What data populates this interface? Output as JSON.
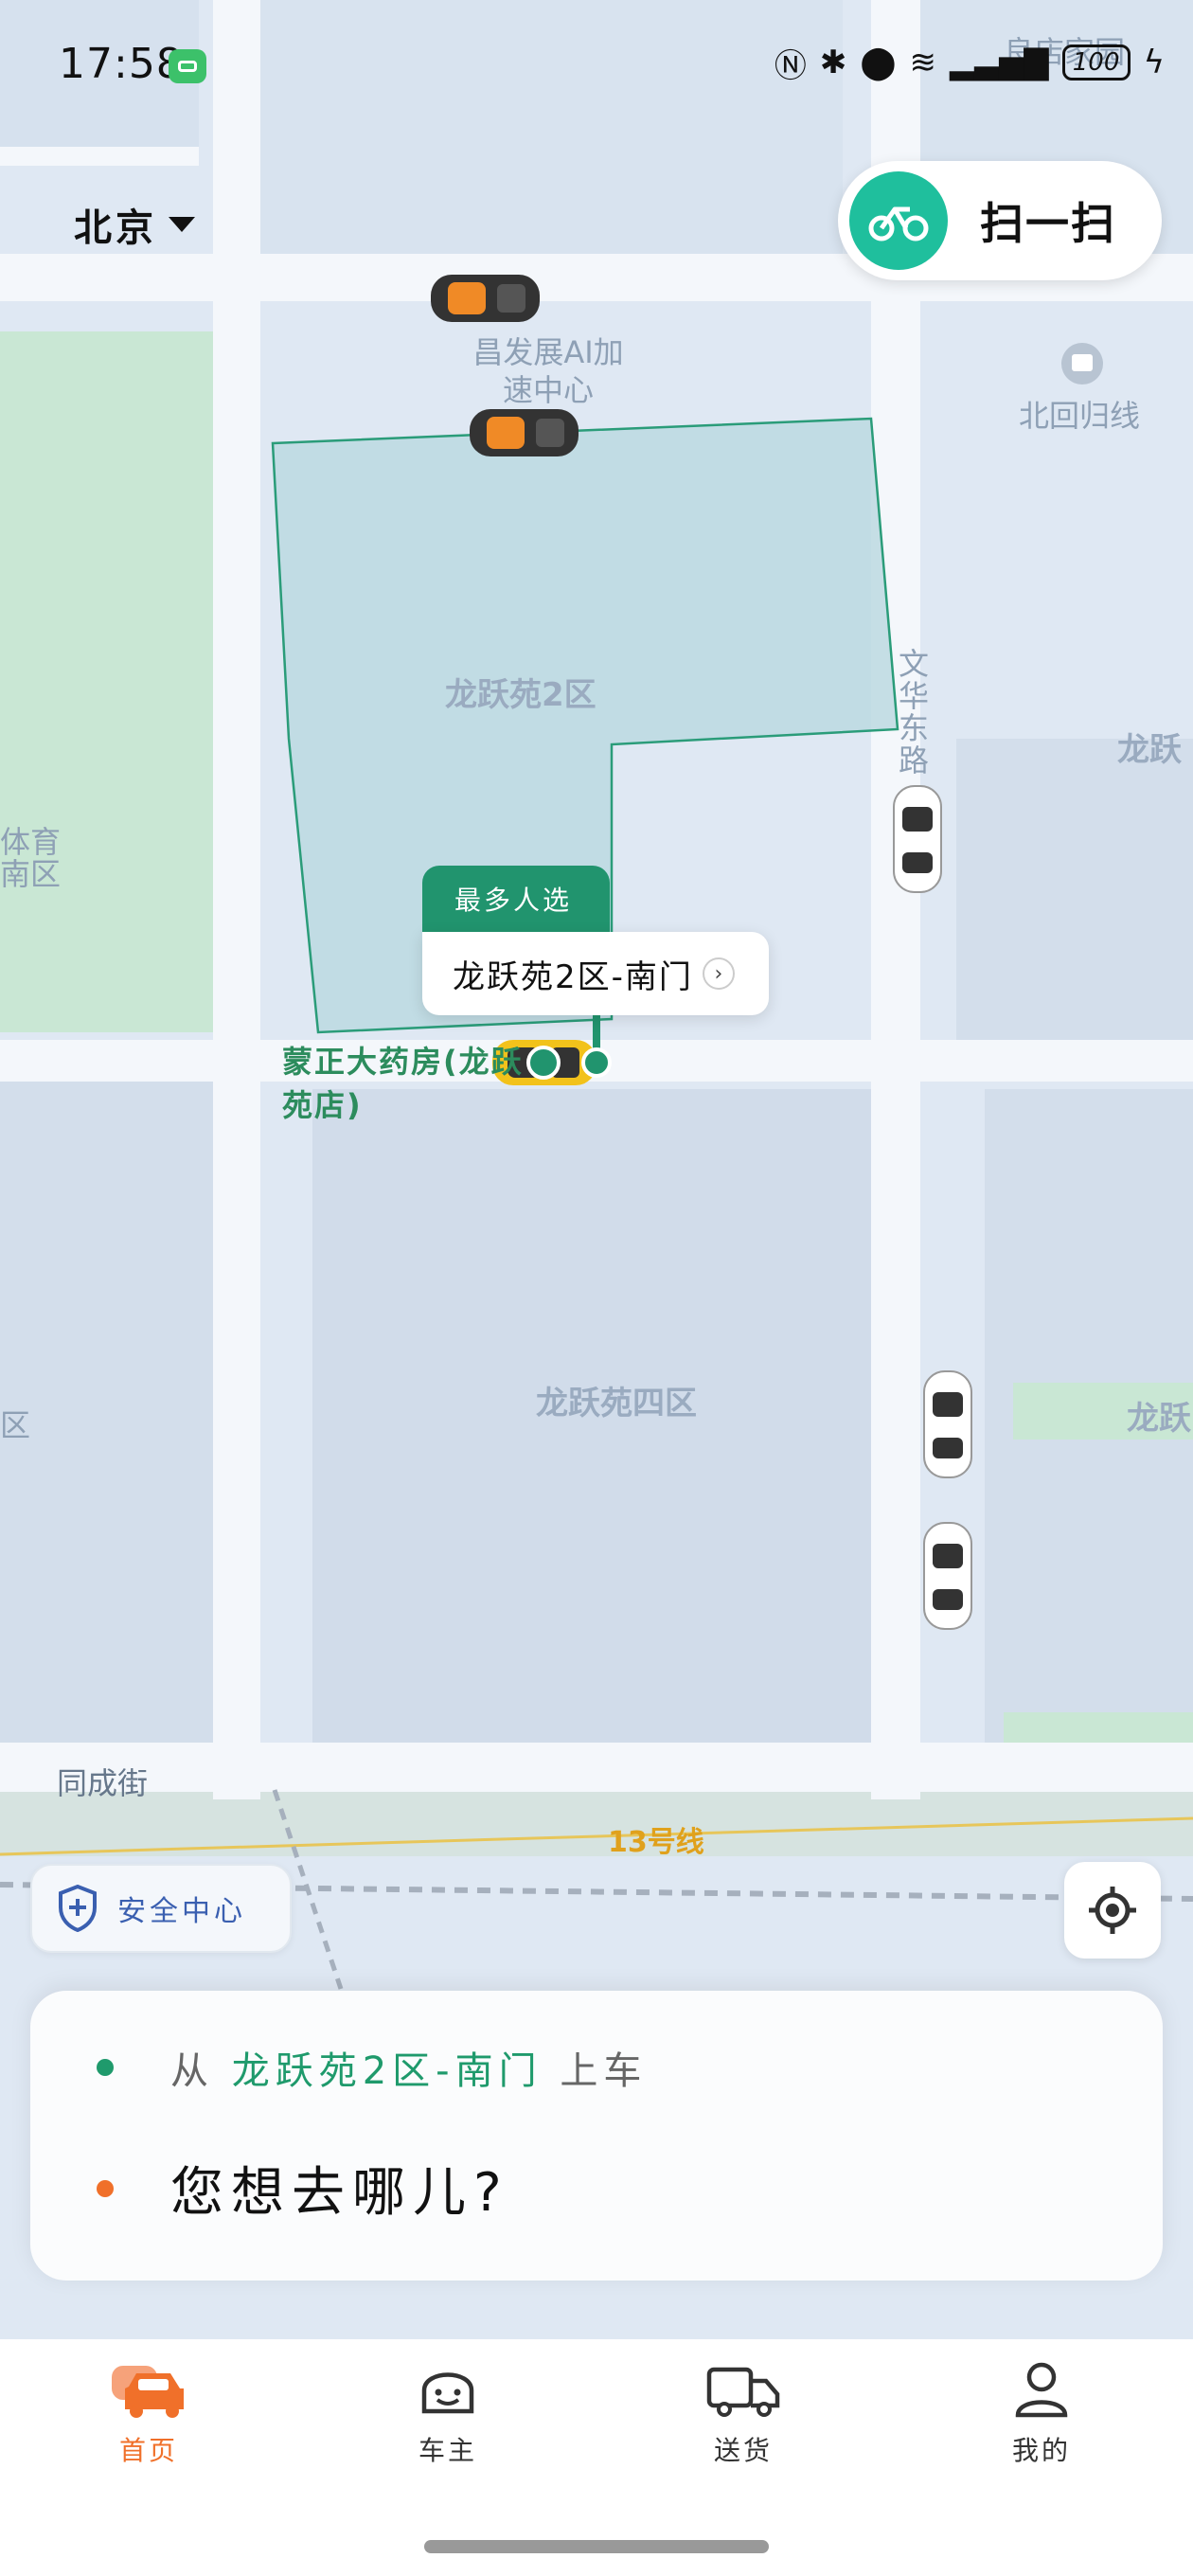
{
  "status_bar": {
    "time": "17:58",
    "battery": "100"
  },
  "header": {
    "city": "北京",
    "scan_label": "扫一扫"
  },
  "map": {
    "labels": {
      "poi_ai_center": "昌发展AI加速中心",
      "beihuiguixian": "北回归线",
      "zone2": "龙跃苑2区",
      "zone4": "龙跃苑四区",
      "wenhua_road": "文华东路",
      "tongcheng_street": "同成街",
      "metro_line": "13号线",
      "edge_top_right": "良店家园",
      "edge_right": "龙跃",
      "edge_right2": "龙跃",
      "edge_left_top": "体育",
      "edge_left_bottom": "南区",
      "edge_left_mid": "区"
    },
    "popular_tag": "最多人选",
    "pickup_point": "龙跃苑2区-南门",
    "pharmacy": "蒙正大药房(龙跃苑店)"
  },
  "safety_center": "安全中心",
  "trip_card": {
    "from_prefix": "从",
    "from_place": "龙跃苑2区-南门",
    "from_suffix": "上车",
    "destination_placeholder": "您想去哪儿?"
  },
  "nav": {
    "items": [
      {
        "label": "首页",
        "active": true
      },
      {
        "label": "车主",
        "active": false
      },
      {
        "label": "送货",
        "active": false
      },
      {
        "label": "我的",
        "active": false
      }
    ]
  },
  "colors": {
    "brand_green": "#21946e",
    "accent_orange": "#f0702a",
    "map_bg": "#dfe8f3"
  }
}
